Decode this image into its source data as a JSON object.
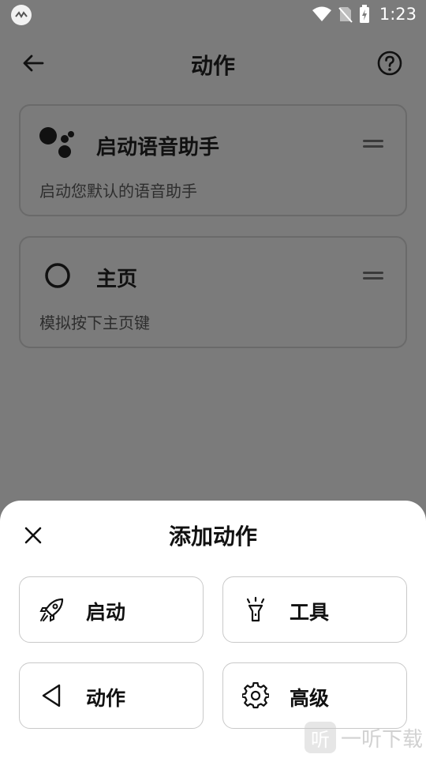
{
  "status": {
    "time": "1:23"
  },
  "header": {
    "title": "动作"
  },
  "actions": [
    {
      "title": "启动语音助手",
      "subtitle": "启动您默认的语音助手",
      "icon": "assistant-icon"
    },
    {
      "title": "主页",
      "subtitle": "模拟按下主页键",
      "icon": "home-circle-icon"
    }
  ],
  "sheet": {
    "title": "添加动作",
    "options": [
      {
        "label": "启动",
        "icon": "rocket-icon"
      },
      {
        "label": "工具",
        "icon": "flashlight-icon"
      },
      {
        "label": "动作",
        "icon": "back-triangle-icon"
      },
      {
        "label": "高级",
        "icon": "gear-icon"
      }
    ]
  },
  "watermark": {
    "text": "一听下载",
    "badge": "听"
  }
}
